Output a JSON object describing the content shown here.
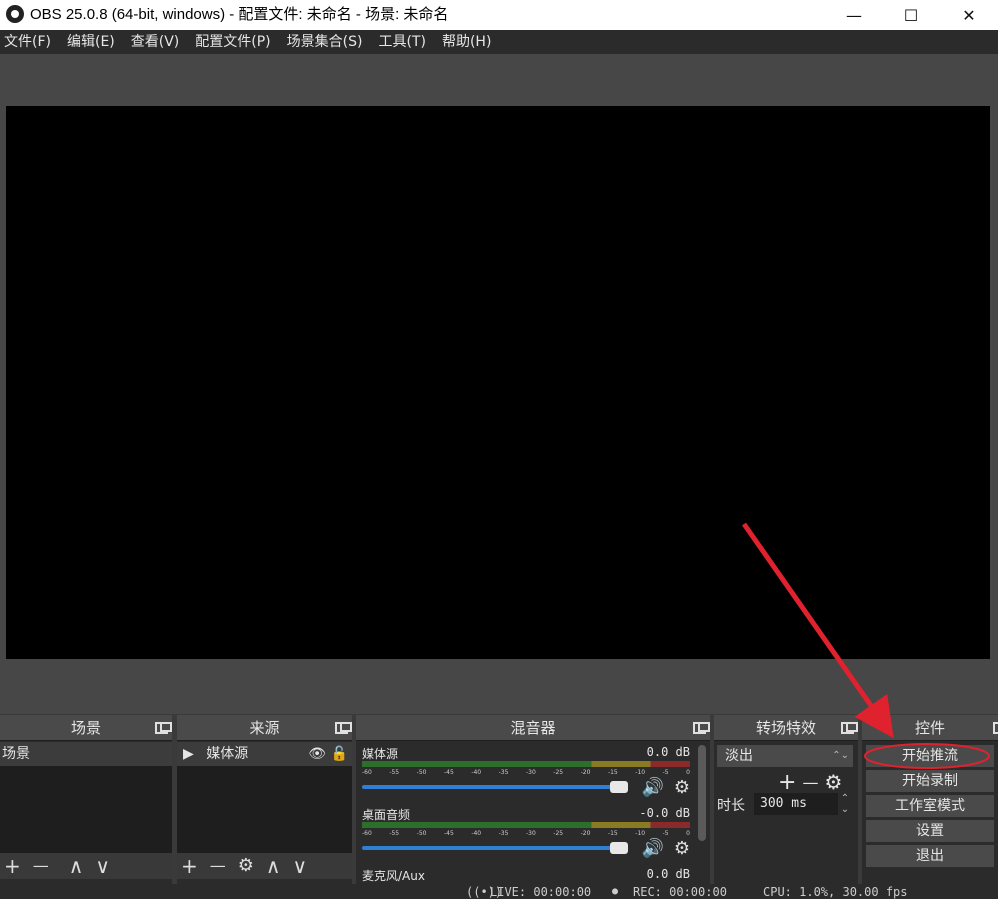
{
  "window": {
    "title": "OBS 25.0.8 (64-bit, windows) - 配置文件: 未命名 - 场景: 未命名",
    "minimize": "—",
    "maximize": "☐",
    "close": "✕"
  },
  "menu": {
    "items": [
      {
        "label": "文件(F)"
      },
      {
        "label": "编辑(E)"
      },
      {
        "label": "查看(V)"
      },
      {
        "label": "配置文件(P)"
      },
      {
        "label": "场景集合(S)"
      },
      {
        "label": "工具(T)"
      },
      {
        "label": "帮助(H)"
      }
    ]
  },
  "scenes": {
    "title": "场景",
    "items": [
      "场景"
    ],
    "tools": {
      "add": "+",
      "remove": "—",
      "up": "∧",
      "down": "∨"
    }
  },
  "sources": {
    "title": "来源",
    "items": [
      {
        "label": "媒体源"
      }
    ],
    "tools": {
      "add": "+",
      "remove": "—",
      "settings": "⚙",
      "up": "∧",
      "down": "∨"
    }
  },
  "mixer": {
    "title": "混音器",
    "ticks": [
      "-60",
      "-55",
      "-50",
      "-45",
      "-40",
      "-35",
      "-30",
      "-25",
      "-20",
      "-15",
      "-10",
      "-5",
      "0"
    ],
    "channels": [
      {
        "name": "媒体源",
        "db": "0.0 dB"
      },
      {
        "name": "桌面音频",
        "db": "-0.0 dB"
      },
      {
        "name": "麦克风/Aux",
        "db": "0.0 dB"
      }
    ]
  },
  "transitions": {
    "title": "转场特效",
    "selected": "淡出",
    "duration_label": "时长",
    "duration_value": "300 ms",
    "add": "+",
    "remove": "—",
    "settings": "⚙"
  },
  "controls": {
    "title": "控件",
    "buttons": [
      "开始推流",
      "开始录制",
      "工作室模式",
      "设置",
      "退出"
    ]
  },
  "status": {
    "live": "LIVE: 00:00:00",
    "rec": "REC: 00:00:00",
    "cpu": "CPU: 1.0%, 30.00 fps"
  },
  "colors": {
    "annotation": "#e0212e",
    "slider": "#2f7fd6"
  }
}
